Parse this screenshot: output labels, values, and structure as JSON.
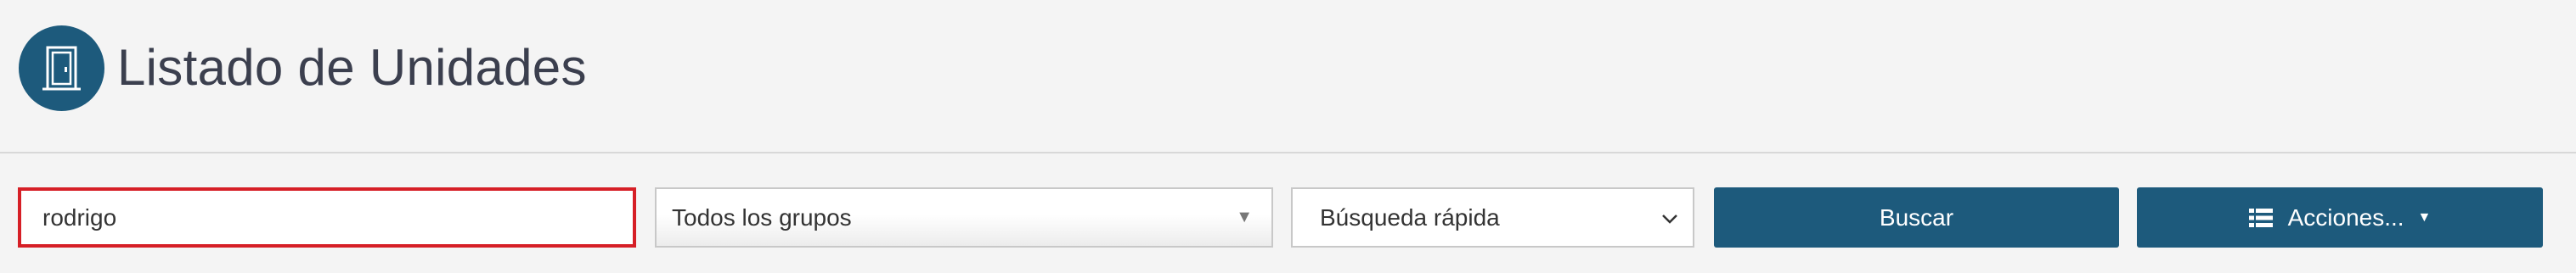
{
  "header": {
    "icon": "door-icon",
    "title": "Listado de Unidades"
  },
  "filters": {
    "search_value": "rodrigo",
    "group_select_value": "Todos los grupos",
    "quick_search_value": "Búsqueda rápida"
  },
  "buttons": {
    "search_label": "Buscar",
    "actions_label": "Acciones...",
    "actions_icon": "list-icon"
  },
  "colors": {
    "primary": "#1d5a7c",
    "focus_border": "#d61f26",
    "background": "#f4f4f4"
  }
}
